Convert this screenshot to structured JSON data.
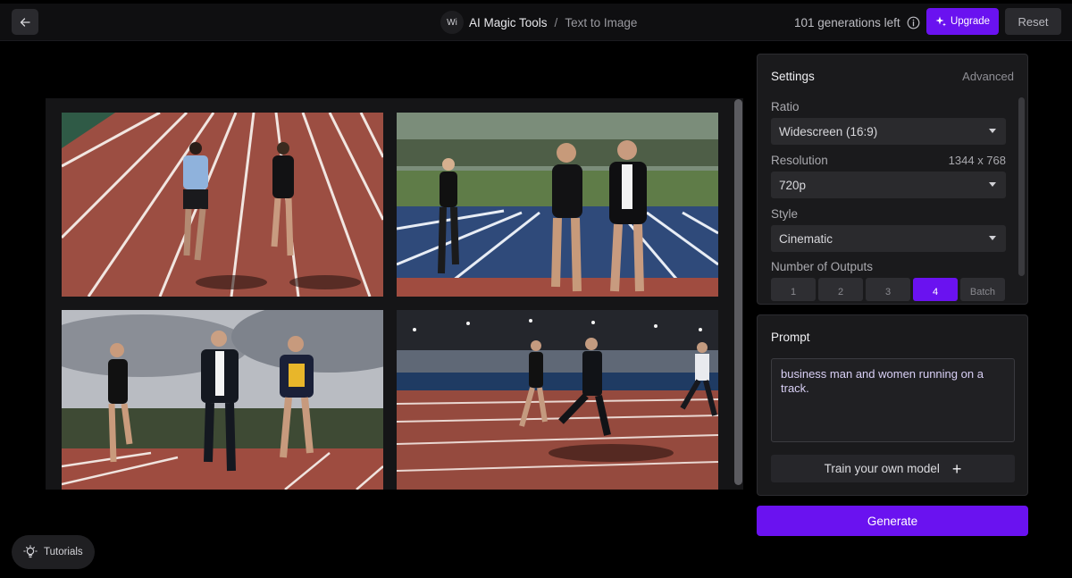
{
  "header": {
    "app_badge": "Wi",
    "app_name": "AI Magic Tools",
    "separator": "/",
    "page_name": "Text to Image",
    "generations_left": "101 generations left",
    "upgrade_label": "Upgrade",
    "reset_label": "Reset"
  },
  "settings": {
    "title": "Settings",
    "advanced_label": "Advanced",
    "ratio_label": "Ratio",
    "ratio_value": "Widescreen (16:9)",
    "resolution_label": "Resolution",
    "resolution_dims": "1344 x 768",
    "resolution_value": "720p",
    "style_label": "Style",
    "style_value": "Cinematic",
    "outputs_label": "Number of Outputs",
    "outputs_options": [
      "1",
      "2",
      "3",
      "4",
      "Batch"
    ],
    "outputs_selected": "4"
  },
  "prompt": {
    "title": "Prompt",
    "text": "business man and women running on a track.",
    "train_label": "Train your own model"
  },
  "generate_label": "Generate",
  "tutorials_label": "Tutorials",
  "colors": {
    "accent": "#6a12f0",
    "panel": "#1a1a1c",
    "track": "#a85a4a"
  }
}
